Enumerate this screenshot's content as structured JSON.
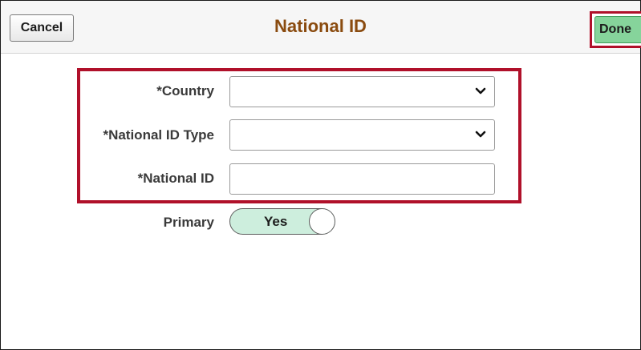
{
  "header": {
    "title": "National ID",
    "cancel_label": "Cancel",
    "done_label": "Done"
  },
  "form": {
    "country": {
      "label": "*Country",
      "value": ""
    },
    "national_id_type": {
      "label": "*National ID Type",
      "value": ""
    },
    "national_id": {
      "label": "*National ID",
      "value": ""
    },
    "primary": {
      "label": "Primary",
      "toggle_text": "Yes",
      "state": "on"
    }
  },
  "colors": {
    "title": "#8a4b0f",
    "highlight_outline": "#b0102a",
    "done_button": "#86d49b",
    "toggle_on": "#cdeedd"
  },
  "icons": {
    "select_arrow": "chevron-down-icon"
  }
}
